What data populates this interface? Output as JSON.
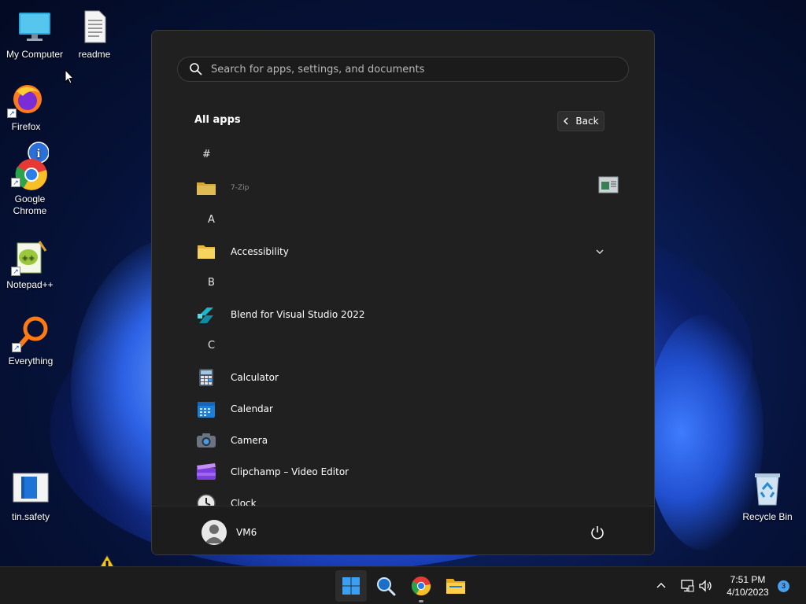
{
  "desktop": {
    "icons": [
      {
        "label": "My Computer"
      },
      {
        "label": "readme"
      },
      {
        "label": "Firefox"
      },
      {
        "label": "Google\nChrome"
      },
      {
        "label": "Notepad++"
      },
      {
        "label": "Everything"
      },
      {
        "label": "tin.safety"
      },
      {
        "label": "Recycle Bin"
      }
    ]
  },
  "start_menu": {
    "search_placeholder": "Search for apps, settings, and documents",
    "section_title": "All apps",
    "back_label": "Back",
    "groups": [
      {
        "letter": "#",
        "apps": [
          {
            "name": "7-Zip",
            "icon": "folder-icon",
            "expandable": true
          }
        ]
      },
      {
        "letter": "A",
        "apps": [
          {
            "name": "Accessibility",
            "icon": "folder-icon",
            "expandable": true
          }
        ]
      },
      {
        "letter": "B",
        "apps": [
          {
            "name": "Blend for Visual Studio 2022",
            "icon": "blend-icon"
          }
        ]
      },
      {
        "letter": "C",
        "apps": [
          {
            "name": "Calculator",
            "icon": "calculator-icon"
          },
          {
            "name": "Calendar",
            "icon": "calendar-icon"
          },
          {
            "name": "Camera",
            "icon": "camera-icon"
          },
          {
            "name": "Clipchamp – Video Editor",
            "icon": "clipchamp-icon"
          },
          {
            "name": "Clock",
            "icon": "clock-icon"
          }
        ]
      }
    ],
    "user": {
      "name": "VM6"
    }
  },
  "taskbar": {
    "time": "7:51 PM",
    "date": "4/10/2023",
    "notification_count": "3"
  },
  "colors": {
    "accent": "#4aa0f0",
    "menu_bg": "#202020",
    "taskbar_bg": "#1c1c1c"
  }
}
